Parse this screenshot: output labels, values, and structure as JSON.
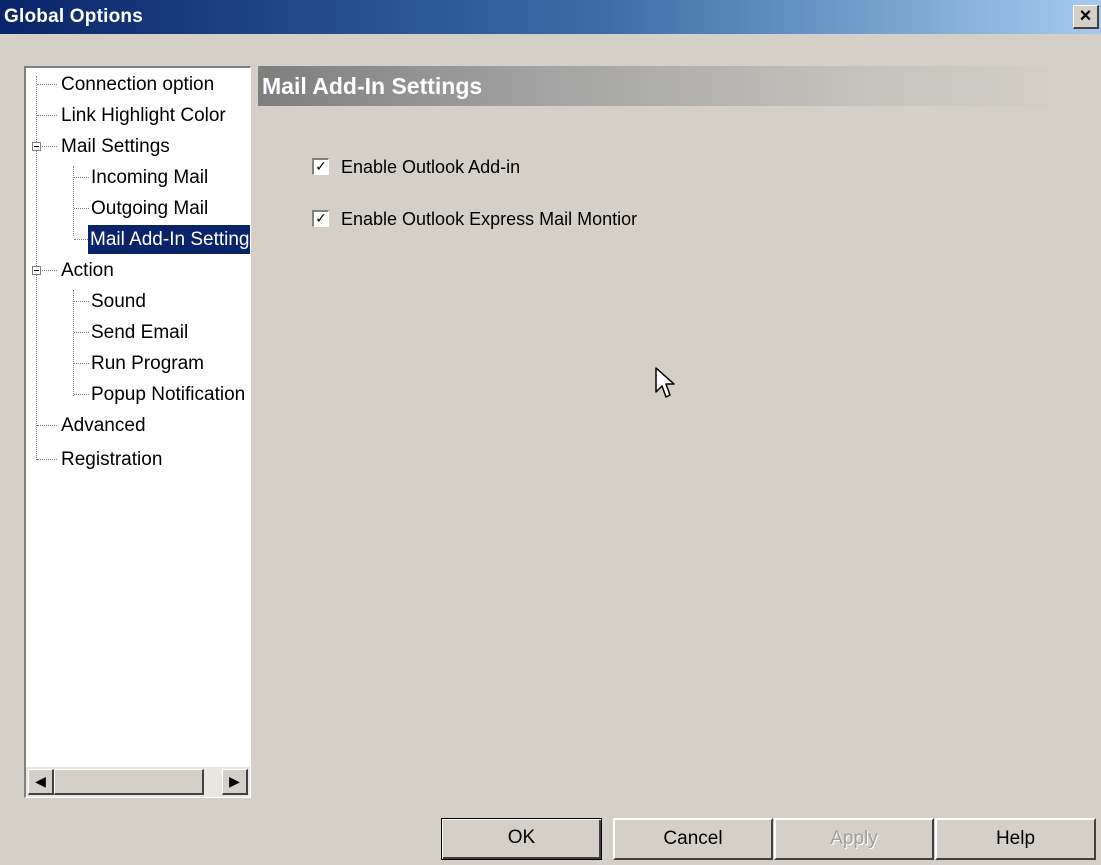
{
  "window": {
    "title": "Global Options",
    "close_symbol": "×"
  },
  "tree": {
    "items": [
      {
        "label": "Connection option"
      },
      {
        "label": "Link Highlight Color"
      },
      {
        "label": "Mail Settings"
      },
      {
        "label": "Incoming Mail"
      },
      {
        "label": "Outgoing Mail"
      },
      {
        "label": "Mail Add-In Settings",
        "selected": true
      },
      {
        "label": "Action"
      },
      {
        "label": "Sound"
      },
      {
        "label": "Send Email"
      },
      {
        "label": "Run Program"
      },
      {
        "label": "Popup Notification"
      },
      {
        "label": "Advanced"
      },
      {
        "label": "Registration"
      }
    ],
    "scroll_left_symbol": "◀",
    "scroll_right_symbol": "▶"
  },
  "panel": {
    "header": "Mail Add-In Settings",
    "checkboxes": [
      {
        "label": "Enable Outlook Add-in",
        "checked": true
      },
      {
        "label": "Enable Outlook Express Mail Montior",
        "checked": true
      }
    ],
    "check_mark": "✓"
  },
  "buttons": {
    "ok": "OK",
    "cancel": "Cancel",
    "apply": "Apply",
    "help": "Help"
  },
  "icons": {
    "cursor": "mouse-pointer-icon",
    "expander": "tree-collapse-icon"
  }
}
